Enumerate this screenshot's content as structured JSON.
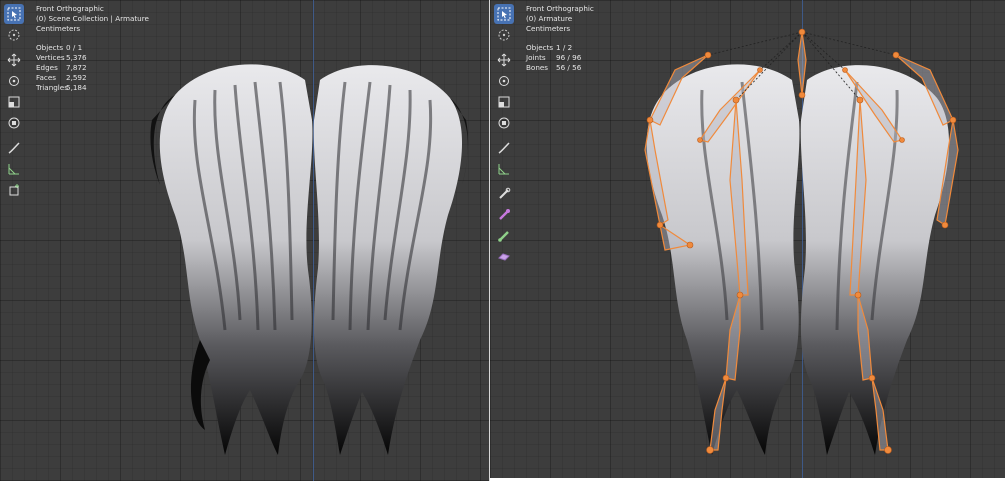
{
  "left_viewport": {
    "view_title": "Front Orthographic",
    "collection": "(0) Scene Collection | Armature",
    "units": "Centimeters",
    "stats": [
      {
        "label": "Objects",
        "value": "0 / 1"
      },
      {
        "label": "Vertices",
        "value": "5,376"
      },
      {
        "label": "Edges",
        "value": "7,872"
      },
      {
        "label": "Faces",
        "value": "2,592"
      },
      {
        "label": "Triangles",
        "value": "5,184"
      }
    ],
    "tools": [
      "select-box-icon",
      "cursor-icon",
      "move-icon",
      "rotate-icon",
      "scale-icon",
      "transform-icon",
      "annotate-icon",
      "measure-icon",
      "add-cube-icon"
    ],
    "active_tool": "select-box-icon"
  },
  "right_viewport": {
    "view_title": "Front Orthographic",
    "collection": "(0) Armature",
    "units": "Centimeters",
    "stats": [
      {
        "label": "Objects",
        "value": "1 / 2"
      },
      {
        "label": "Joints",
        "value": "96 / 96"
      },
      {
        "label": "Bones",
        "value": "56 / 56"
      }
    ],
    "tools": [
      "select-box-icon",
      "cursor-icon",
      "move-icon",
      "rotate-icon",
      "scale-icon",
      "transform-icon",
      "annotate-icon",
      "measure-icon",
      "bone-size-icon",
      "bone-envelope-icon",
      "roll-icon",
      "extrude-icon"
    ],
    "active_tool": "select-box-icon"
  },
  "colors": {
    "viewport_bg": "#3d3d3d",
    "active_tool": "#4772b3",
    "axis_line": "#3f5f95",
    "bone_selected": "#f08a3c"
  }
}
